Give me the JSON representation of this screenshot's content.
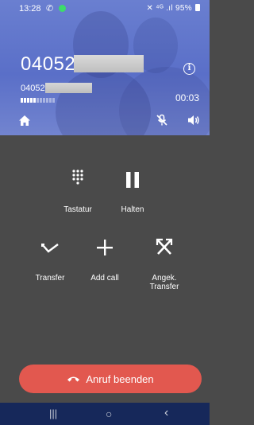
{
  "status_bar": {
    "time": "13:28",
    "right_text": "✕ ⁴ᴳ .ıl 95%",
    "icons": [
      "phone-icon",
      "green-dot-indicator",
      "battery-icon"
    ]
  },
  "call": {
    "number_visible": "04052",
    "sub_number_visible": "04052",
    "duration": "00:03"
  },
  "actions": {
    "keypad_label": "Tastatur",
    "hold_label": "Halten",
    "transfer_label": "Transfer",
    "add_call_label": "Add call",
    "attended_transfer_label": "Angek. Transfer"
  },
  "end_call": {
    "label": "Anruf beenden"
  },
  "navigation": {
    "recents": "|||",
    "home": "○",
    "back": "‹"
  },
  "colors": {
    "header_top": "#6a7fd0",
    "header_bottom": "#7284cf",
    "background": "#4a4a4a",
    "end_call": "#e2584f",
    "nav_bar": "#16285a",
    "online_dot": "#3ddc6b"
  }
}
